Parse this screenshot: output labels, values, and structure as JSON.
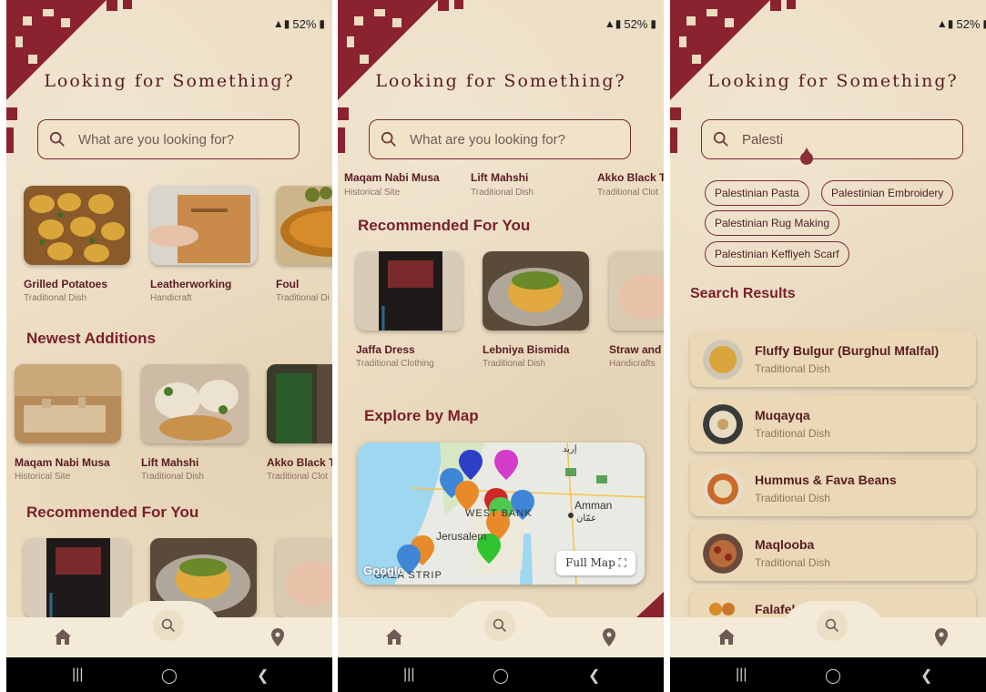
{
  "status": {
    "battery": "52%"
  },
  "header": {
    "title": "Looking for Something?"
  },
  "search": {
    "placeholder": "What are you looking for?",
    "typed_value": "Palesti"
  },
  "screen1": {
    "featured": [
      {
        "name": "Grilled Potatoes",
        "category": "Traditional Dish"
      },
      {
        "name": "Leatherworking",
        "category": "Handicraft"
      },
      {
        "name": "Foul",
        "category": "Traditional Di"
      }
    ],
    "newest_title": "Newest Additions",
    "newest": [
      {
        "name": "Maqam Nabi Musa",
        "category": "Historical Site"
      },
      {
        "name": "Lift Mahshi",
        "category": "Traditional Dish"
      },
      {
        "name": "Akko Black T",
        "category": "Traditional Clot"
      }
    ],
    "recommended_title": "Recommended For You"
  },
  "screen2": {
    "top_row": [
      {
        "name": "Maqam Nabi Musa",
        "category": "Historical Site"
      },
      {
        "name": "Lift Mahshi",
        "category": "Traditional Dish"
      },
      {
        "name": "Akko Black T",
        "category": "Traditional Clot"
      }
    ],
    "recommended_title": "Recommended For You",
    "recommended": [
      {
        "name": "Jaffa Dress",
        "category": "Traditional Clothing"
      },
      {
        "name": "Lebniya Bismida",
        "category": "Traditional Dish"
      },
      {
        "name": "Straw and I",
        "category": "Handicrafts"
      }
    ],
    "map_title": "Explore by Map",
    "map": {
      "full_map_label": "Full Map",
      "labels": [
        "Amman",
        "عمّان",
        "Jerusalem",
        "WEST BANK",
        "GAZA STRIP",
        "Google",
        "إربد"
      ]
    }
  },
  "screen3": {
    "suggestions": [
      "Palestinian Pasta",
      "Palestinian Embroidery",
      "Palestinian Rug Making",
      "Palestinian Keffiyeh Scarf"
    ],
    "results_title": "Search Results",
    "results": [
      {
        "name": "Fluffy Bulgur (Burghul Mfalfal)",
        "category": "Traditional Dish"
      },
      {
        "name": "Muqayqa",
        "category": "Traditional Dish"
      },
      {
        "name": "Hummus & Fava Beans",
        "category": "Traditional Dish"
      },
      {
        "name": "Maqlooba",
        "category": "Traditional Dish"
      },
      {
        "name": "Falafel",
        "category": ""
      }
    ]
  },
  "nav": {
    "items": [
      "home-icon",
      "search-icon",
      "location-pin-icon"
    ]
  },
  "colors": {
    "accent": "#7a1f2b",
    "background": "#ecdcc0",
    "navbar": "#f3ead8"
  }
}
